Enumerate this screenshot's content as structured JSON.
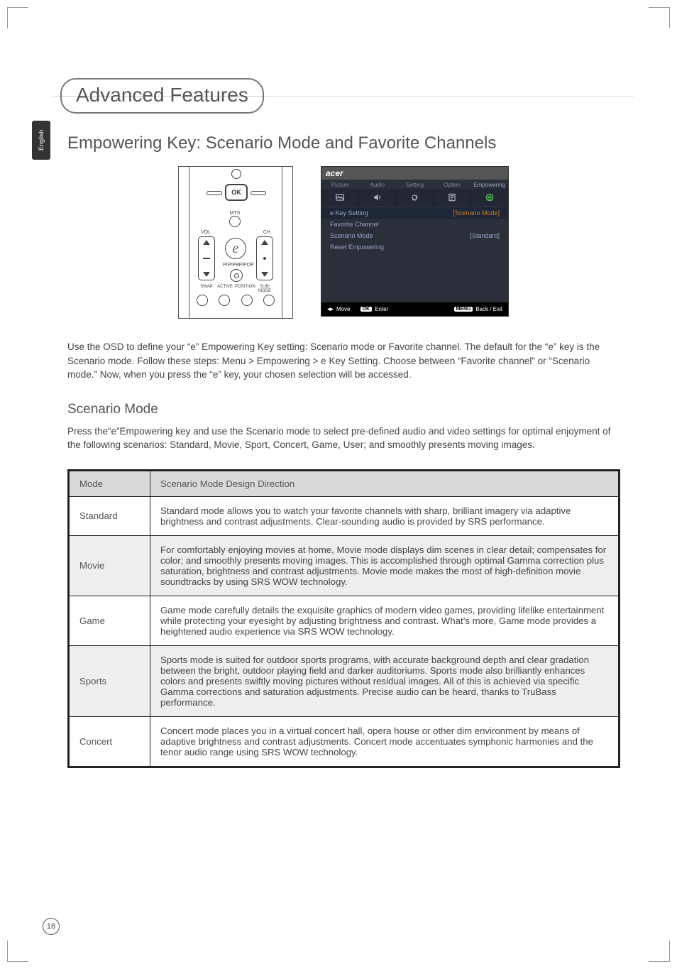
{
  "language_tab": "English",
  "chapter_title": "Advanced Features",
  "section_title": "Empowering Key: Scenario Mode and Favorite Channels",
  "remote": {
    "ok": "OK",
    "mts": "MTS",
    "vol": "VOL",
    "ch": "CH",
    "e": "e",
    "pip": "PIP/PBP/POP",
    "swap": "SWAP",
    "active": "ACTIVE",
    "position": "POSITION",
    "subimode": "SUB/\nMODE"
  },
  "osd": {
    "brand": "acer",
    "tabs": [
      "Picture",
      "Audio",
      "Setting",
      "Option",
      "Empowering"
    ],
    "rows": [
      {
        "label": "e Key Setting",
        "value": "[Scenario Mode]",
        "highlight": true,
        "accent": true
      },
      {
        "label": "Favorite Channel",
        "value": ""
      },
      {
        "label": "Scenario Mode",
        "value": "[Standard]"
      },
      {
        "label": "Reset Empowering",
        "value": ""
      }
    ],
    "footer": {
      "move": "Move",
      "enter_chip": "OK",
      "enter": "Enter",
      "menu_chip": "MENU",
      "backexit": "Back / Exit"
    }
  },
  "intro_paragraph": "Use the OSD to define your “e” Empowering Key setting: Scenario mode or Favorite channel. The default for the “e” key is the Scenario mode. Follow these steps: Menu > Empowering > e Key Setting. Choose between “Favorite channel” or “Scenario mode.” Now, when you press the “e” key, your chosen selection will be accessed.",
  "subsection_title": "Scenario Mode",
  "subsection_intro": "Press the“e”Empowering key and use the Scenario mode to select pre-defined audio and video settings for optimal enjoyment of the following scenarios: Standard, Movie, Sport, Concert, Game, User; and smoothly presents moving images.",
  "table": {
    "headers": [
      "Mode",
      "Scenario Mode Design Direction"
    ],
    "rows": [
      {
        "mode": "Standard",
        "desc": "Standard mode allows you to watch your favorite channels with sharp, brilliant imagery via adaptive brightness and contrast adjustments. Clear-sounding audio is provided by SRS performance."
      },
      {
        "mode": "Movie",
        "desc": "For comfortably enjoying movies at home, Movie mode displays dim scenes in clear detail; compensates for color; and smoothly presents moving images. This is accomplished through optimal Gamma correction plus saturation, brightness and contrast adjustments. Movie mode makes the most of high-definition movie soundtracks by using SRS WOW technology."
      },
      {
        "mode": "Game",
        "desc": "Game mode carefully details the exquisite graphics of modern video games, providing lifelike entertainment while protecting your eyesight by adjusting brightness and contrast. What’s more, Game mode provides a heightened audio experience via SRS WOW technology."
      },
      {
        "mode": "Sports",
        "desc": "Sports mode is suited for outdoor sports programs, with accurate background depth and clear gradation between the bright, outdoor playing field and darker auditoriums. Sports mode also brilliantly enhances colors and presents swiftly moving pictures without residual images. All of this is achieved via specific Gamma corrections and saturation adjustments. Precise audio can be heard, thanks to TruBass performance."
      },
      {
        "mode": "Concert",
        "desc": "Concert mode places you in a virtual concert hall, opera house or other dim environment by means of adaptive brightness and contrast adjustments. Concert mode accentuates symphonic harmonies and the tenor audio range using SRS WOW technology."
      }
    ]
  },
  "page_number": "18"
}
